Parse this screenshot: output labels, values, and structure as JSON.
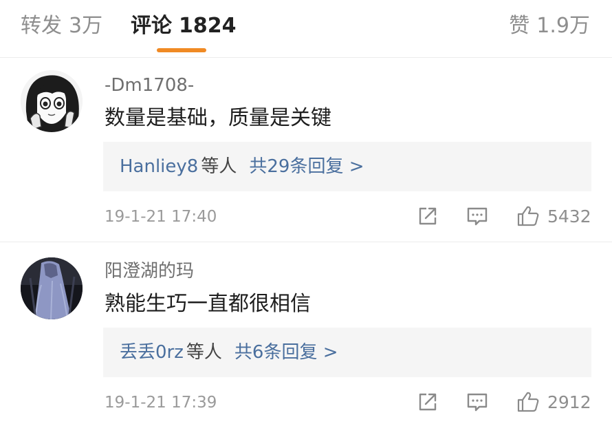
{
  "tabs": {
    "repost_label": "转发",
    "repost_count": "3万",
    "comments_label": "评论",
    "comments_count": "1824",
    "likes_label": "赞",
    "likes_count": "1.9万",
    "active_color": "#f08a24"
  },
  "comments": [
    {
      "username": "-Dm1708-",
      "text": "数量是基础，质量是关键",
      "reply_users": "Hanliey8",
      "reply_mid": "等人",
      "reply_count": "共29条回复 >",
      "time": "19-1-21 17:40",
      "likes": "5432",
      "avatar_icon": "manga-girl-avatar"
    },
    {
      "username": "阳澄湖的玛",
      "text": "熟能生巧一直都很相信",
      "reply_users": "丢丢0rz",
      "reply_mid": "等人",
      "reply_count": "共6条回复 >",
      "time": "19-1-21 17:39",
      "likes": "2912",
      "avatar_icon": "figure-in-white-robe-avatar"
    }
  ],
  "icons": {
    "share": "share-icon",
    "reply": "comment-icon",
    "like": "thumbs-up-icon"
  },
  "colors": {
    "link_blue": "#4a6f9e",
    "reply_bg": "#f5f5f5",
    "accent_orange": "#f08a24"
  }
}
